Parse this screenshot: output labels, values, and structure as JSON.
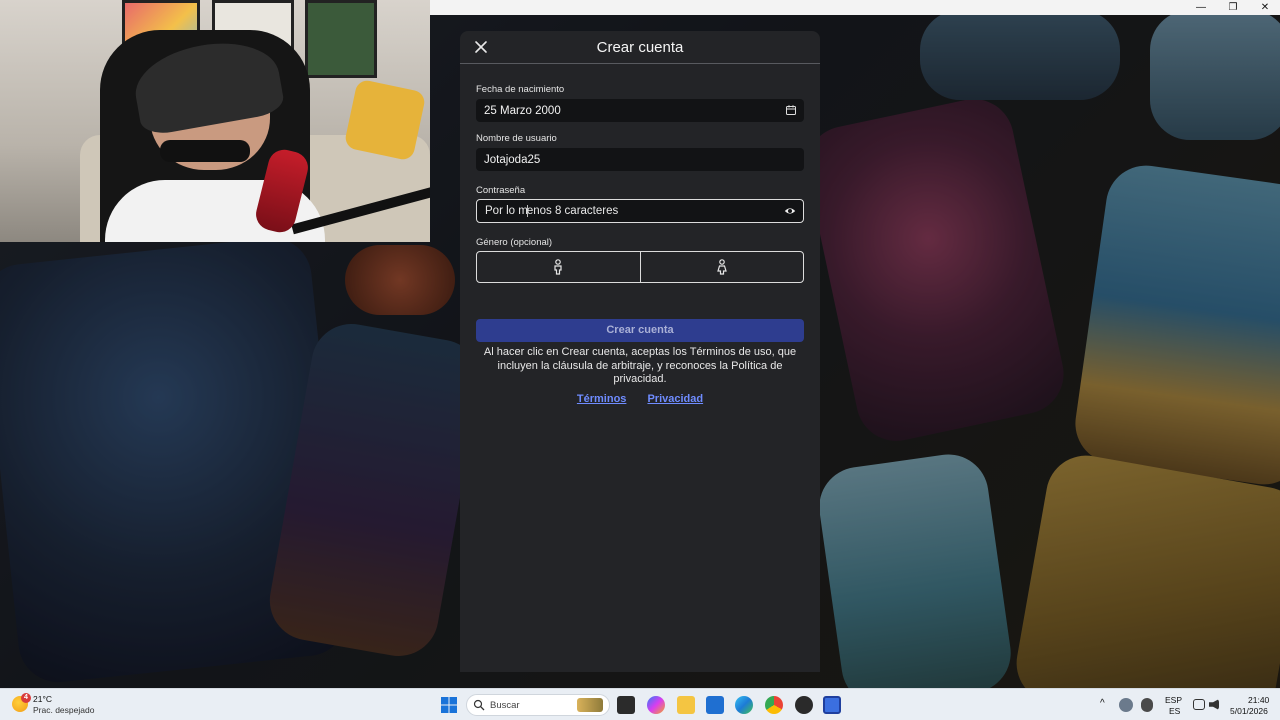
{
  "window": {
    "min_glyph": "—",
    "max_glyph": "❐",
    "close_glyph": "✕"
  },
  "modal": {
    "title": "Crear cuenta",
    "birthdate": {
      "label": "Fecha de nacimiento",
      "value": "25 Marzo 2000",
      "icon": "calendar-icon"
    },
    "username": {
      "label": "Nombre de usuario",
      "value": "Jotajoda25"
    },
    "password": {
      "label": "Contraseña",
      "placeholder_a": "Por lo m",
      "placeholder_b": "enos 8 caracteres",
      "icon": "eye-icon"
    },
    "gender": {
      "label": "Género (opcional)",
      "options": [
        "male-icon",
        "female-icon"
      ]
    },
    "submit_label": "Crear cuenta",
    "legal_text": "Al hacer clic en Crear cuenta, aceptas los Términos de uso, que incluyen la cláusula de arbitraje, y reconoces la Política de privacidad.",
    "links": {
      "terms": "Términos",
      "privacy": "Privacidad"
    }
  },
  "taskbar": {
    "weather": {
      "badge": "4",
      "temperature": "21°C",
      "description": "Prac. despejado"
    },
    "search_placeholder": "Buscar",
    "language": {
      "line1": "ESP",
      "line2": "ES"
    },
    "clock": {
      "time": "21:40",
      "date": "5/01/2026"
    }
  },
  "colors": {
    "accent": "#2e3d8f",
    "link": "#6f8cff",
    "modal_bg": "#232427",
    "field_bg": "#121315"
  }
}
